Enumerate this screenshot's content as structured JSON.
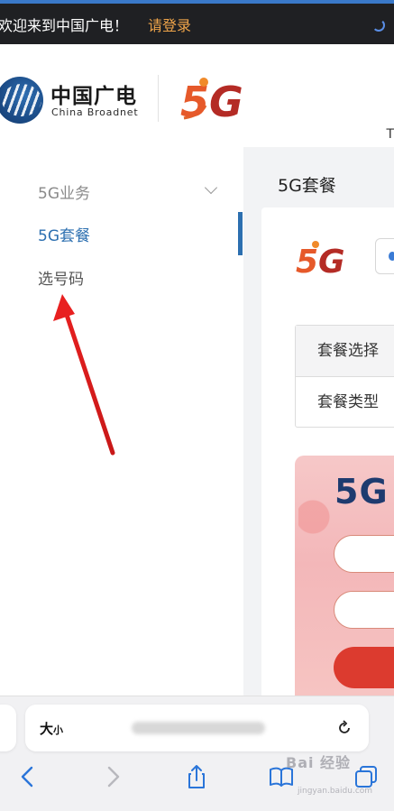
{
  "banner": {
    "welcome_text": "欢迎来到中国广电！",
    "login_link": "请登录"
  },
  "header": {
    "logo_cn": "中国广电",
    "logo_en": "China Broadnet",
    "brand_5g": "5G",
    "truncated_glyph": "T"
  },
  "sidebar": {
    "items": [
      {
        "label": "5G业务",
        "type": "group",
        "expanded": true
      },
      {
        "label": "5G套餐",
        "type": "link",
        "active": true
      },
      {
        "label": "选号码",
        "type": "link",
        "active": false
      }
    ]
  },
  "main": {
    "title": "5G套餐",
    "card_brand": "5G",
    "options": [
      {
        "label": "套餐选择"
      },
      {
        "label": "套餐类型"
      }
    ],
    "promo_heading": "5G"
  },
  "browser": {
    "text_size_label_big": "大",
    "text_size_label_small": "小",
    "watermark": "Bai 经验",
    "watermark_sub": "jingyan.baidu.com"
  },
  "colors": {
    "accent_blue": "#2c6fb0",
    "login_orange": "#f0a54a",
    "brand_red": "#d53b2a",
    "banner_bg": "#1f2023",
    "arrow_red": "#e02020"
  },
  "icons": [
    "spinner-icon",
    "chevron-down-icon",
    "reload-icon",
    "back-icon",
    "forward-icon",
    "share-icon",
    "bookmarks-icon",
    "tabs-icon"
  ]
}
